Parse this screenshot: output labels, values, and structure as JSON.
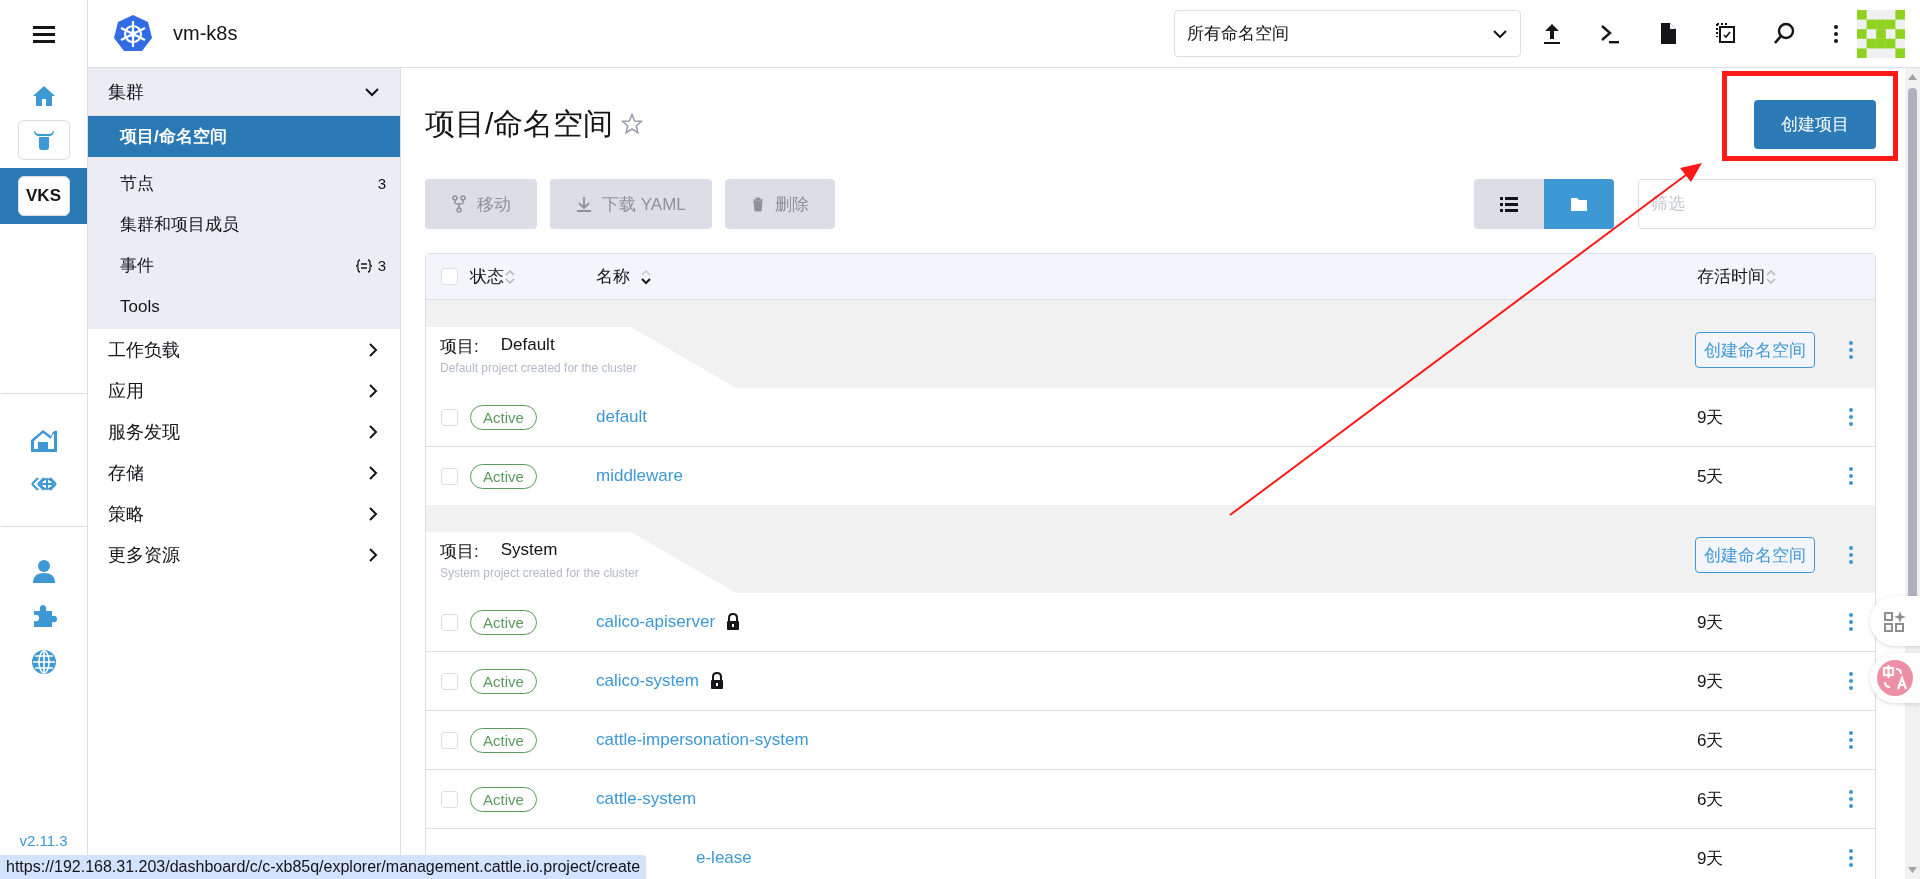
{
  "header": {
    "cluster_name": "vm-k8s",
    "namespace_select": {
      "value": "所有命名空间"
    }
  },
  "rail": {
    "clusters": [
      {
        "kind": "icon",
        "selected": false
      },
      {
        "kind": "text",
        "label": "VKS",
        "selected": true
      }
    ],
    "version": "v2.11.3"
  },
  "nav": {
    "groups": [
      {
        "label": "集群",
        "expanded": true,
        "children": [
          {
            "label": "项目/命名空间",
            "selected": true
          },
          {
            "label": "节点",
            "count": "3",
            "selected": false
          },
          {
            "label": "集群和项目成员",
            "selected": false
          },
          {
            "label": "事件",
            "count": "3",
            "kind": "events",
            "selected": false
          },
          {
            "label": "Tools",
            "selected": false
          }
        ]
      },
      {
        "label": "工作负载",
        "expanded": false
      },
      {
        "label": "应用",
        "expanded": false
      },
      {
        "label": "服务发现",
        "expanded": false
      },
      {
        "label": "存储",
        "expanded": false
      },
      {
        "label": "策略",
        "expanded": false
      },
      {
        "label": "更多资源",
        "expanded": false
      }
    ]
  },
  "page": {
    "title": "项目/命名空间",
    "favorite": false,
    "create_button": "创建项目",
    "toolbar": [
      {
        "kind": "move",
        "label": "移动",
        "disabled": true
      },
      {
        "kind": "download",
        "label": "下载 YAML",
        "disabled": true
      },
      {
        "kind": "delete",
        "label": "删除",
        "disabled": true
      }
    ],
    "view_toggle": [
      {
        "kind": "list",
        "selected": false
      },
      {
        "kind": "folder",
        "selected": true
      }
    ],
    "filter": {
      "placeholder": "筛选"
    }
  },
  "table": {
    "select_all": {
      "checked": false
    },
    "columns": [
      {
        "label": "状态",
        "sorted": false
      },
      {
        "label": "名称",
        "sorted": true
      },
      {
        "label": "存活时间",
        "sorted": false
      }
    ],
    "groups": [
      {
        "label": "项目:",
        "name": "Default",
        "description": "Default project created for the cluster",
        "action": "创建命名空间",
        "rows": [
          {
            "kind": "full",
            "checked": false,
            "status": "Active",
            "name": "default",
            "locked": false,
            "age": "9天"
          },
          {
            "kind": "full",
            "checked": false,
            "status": "Active",
            "name": "middleware",
            "locked": false,
            "age": "5天"
          }
        ]
      },
      {
        "label": "项目:",
        "name": "System",
        "description": "System project created for the cluster",
        "action": "创建命名空间",
        "rows": [
          {
            "kind": "full",
            "checked": false,
            "status": "Active",
            "name": "calico-apiserver",
            "locked": true,
            "age": "9天"
          },
          {
            "kind": "full",
            "checked": false,
            "status": "Active",
            "name": "calico-system",
            "locked": true,
            "age": "9天"
          },
          {
            "kind": "full",
            "checked": false,
            "status": "Active",
            "name": "cattle-impersonation-system",
            "locked": false,
            "age": "6天"
          },
          {
            "kind": "full",
            "checked": false,
            "status": "Active",
            "name": "cattle-system",
            "locked": false,
            "age": "6天"
          },
          {
            "kind": "partial",
            "name": "e-lease",
            "age": "9天"
          }
        ]
      }
    ]
  },
  "status_url": "https://192.168.31.203/dashboard/c/c-xb85q/explorer/management.cattle.io.project/create"
}
